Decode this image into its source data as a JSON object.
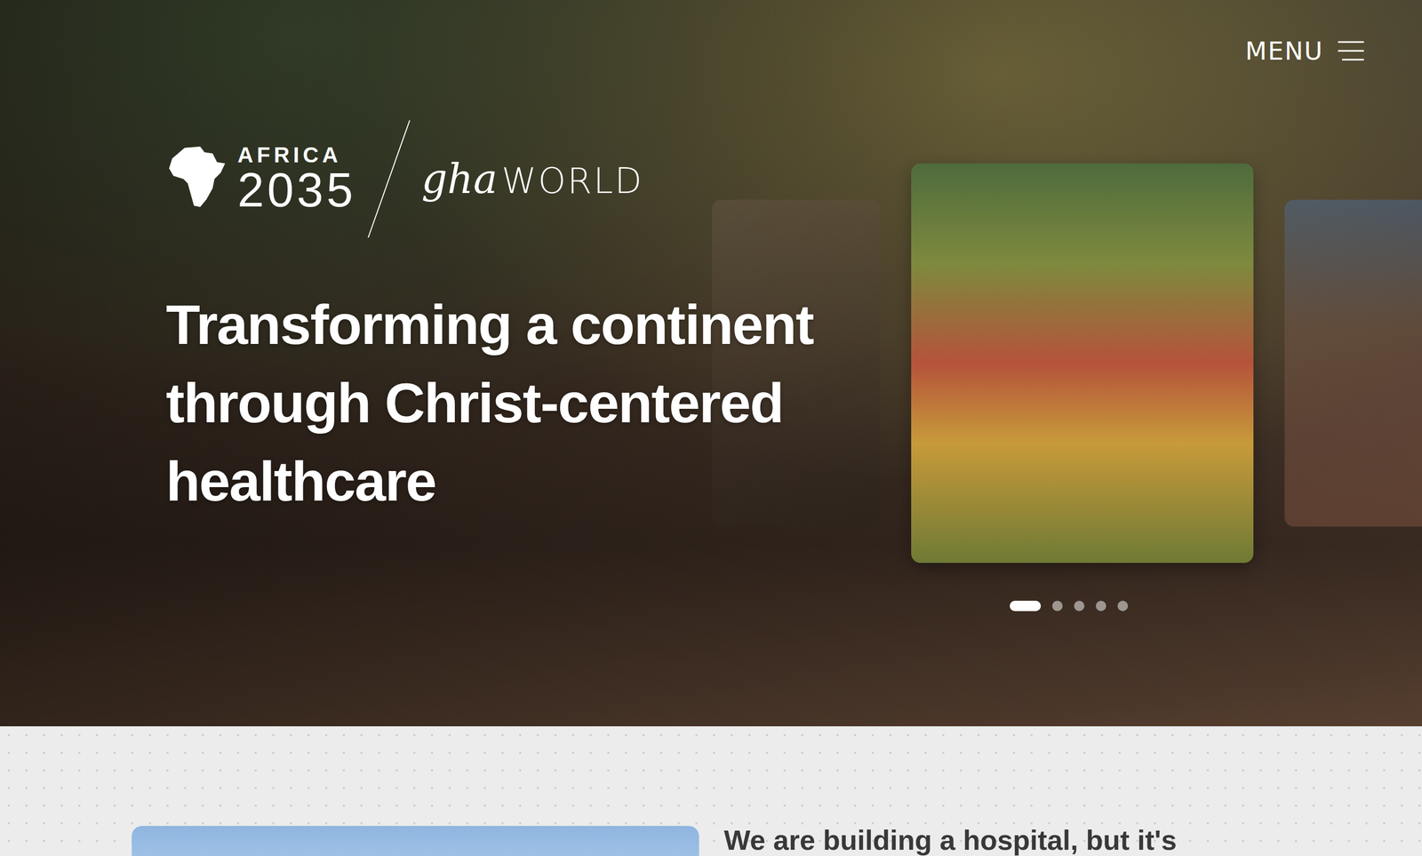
{
  "header": {
    "menu_label": "MENU"
  },
  "logo": {
    "africa": "AFRICA",
    "year": "2035",
    "partner_mark": "gha",
    "partner_name": "WORLD"
  },
  "hero": {
    "title": "Transforming a continent through Christ-centered healthcare"
  },
  "carousel": {
    "slides": [
      {
        "selected": false
      },
      {
        "selected": true
      },
      {
        "selected": false
      }
    ],
    "dots": [
      {
        "selected": true
      },
      {
        "selected": false
      },
      {
        "selected": false
      },
      {
        "selected": false
      },
      {
        "selected": false
      }
    ]
  },
  "intro": {
    "heading": "We are building a hospital, but it's"
  }
}
